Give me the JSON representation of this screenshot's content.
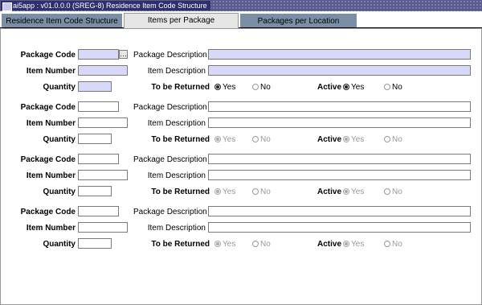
{
  "window": {
    "title": "ai5app : v01.0.0.0 (SREG-8) Residence Item Code Structure"
  },
  "tabs": [
    "Residence Item Code Structure",
    "Items per Package",
    "Packages per Location"
  ],
  "labels": {
    "package_code": "Package Code",
    "package_description": "Package Description",
    "item_number": "Item Number",
    "item_description": "Item Description",
    "quantity": "Quantity",
    "to_be_returned": "To be Returned",
    "active": "Active",
    "yes": "Yes",
    "no": "No",
    "ellipsis": "…"
  },
  "records": [
    {
      "package_code": "",
      "package_description": "",
      "item_number": "",
      "item_description": "",
      "quantity": "",
      "to_be_returned": "Yes",
      "active": "Yes"
    },
    {
      "package_code": "",
      "package_description": "",
      "item_number": "",
      "item_description": "",
      "quantity": "",
      "to_be_returned": "Yes",
      "active": "Yes"
    },
    {
      "package_code": "",
      "package_description": "",
      "item_number": "",
      "item_description": "",
      "quantity": "",
      "to_be_returned": "Yes",
      "active": "Yes"
    },
    {
      "package_code": "",
      "package_description": "",
      "item_number": "",
      "item_description": "",
      "quantity": "",
      "to_be_returned": "Yes",
      "active": "Yes"
    }
  ]
}
